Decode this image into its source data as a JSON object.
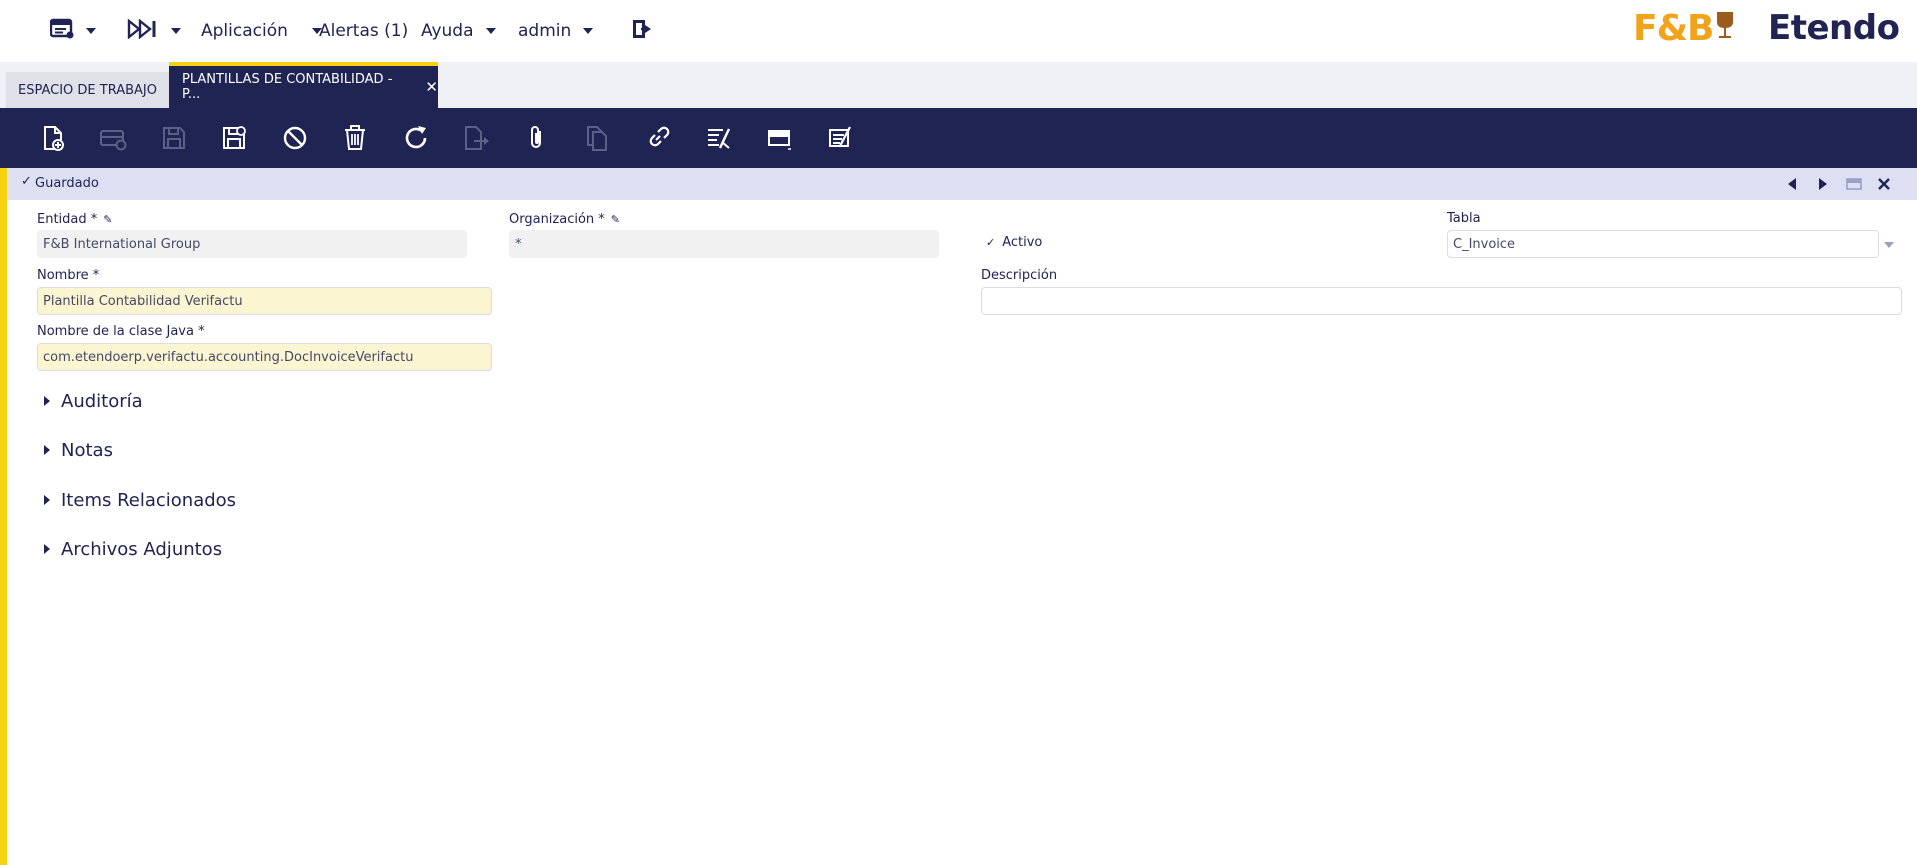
{
  "topnav": {
    "app_menu_icon": "window-list-icon",
    "quick_launch_icon": "fast-forward-icon",
    "menu_application": "Aplicación",
    "menu_alerts": "Alertas (1)",
    "menu_help": "Ayuda",
    "menu_user": "admin",
    "logout_icon": "logout-icon",
    "brand_left": "F&B",
    "brand_right": "Etendo"
  },
  "tabs": {
    "workspace": "ESPACIO DE TRABAJO",
    "active": "PLANTILLAS DE CONTABILIDAD - P...",
    "close_glyph": "✕"
  },
  "toolbar": {
    "buttons": [
      "new-document-icon",
      "new-row-icon",
      "save-icon",
      "save-close-icon",
      "cancel-icon",
      "delete-icon",
      "refresh-icon",
      "export-icon",
      "attach-icon",
      "copy-icon",
      "link-icon",
      "audit-icon",
      "grid-form-icon",
      "notes-icon"
    ]
  },
  "status": {
    "check": "✓",
    "text": "Guardado"
  },
  "form": {
    "entidad_label": "Entidad *",
    "entidad_value": "F&B International Group",
    "organizacion_label": "Organización *",
    "organizacion_value": "*",
    "activo_label": "Activo",
    "tabla_label": "Tabla",
    "tabla_value": "C_Invoice",
    "nombre_label": "Nombre *",
    "nombre_value": "Plantilla Contabilidad Verifactu",
    "descripcion_label": "Descripción",
    "descripcion_value": "",
    "java_label": "Nombre de la clase Java *",
    "java_value": "com.etendoerp.verifactu.accounting.DocInvoiceVerifactu"
  },
  "sections": [
    "Auditoría",
    "Notas",
    "Items Relacionados",
    "Archivos Adjuntos"
  ],
  "colors": {
    "navy": "#202452",
    "accent_yellow": "#f7d213",
    "status_bg": "#dde0f3",
    "required_bg": "#fbf5d2"
  }
}
